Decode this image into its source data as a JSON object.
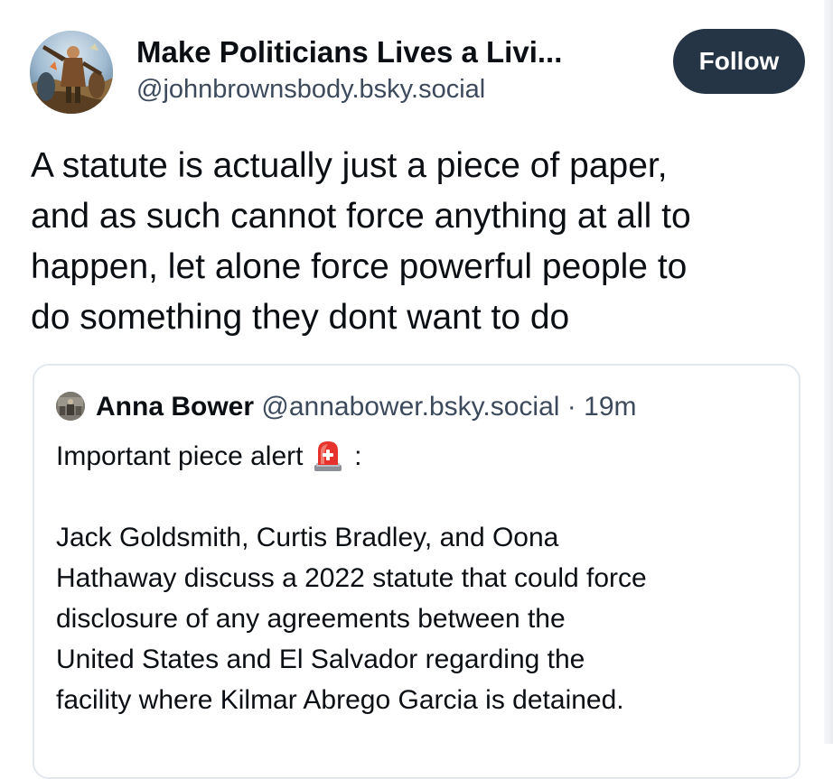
{
  "post": {
    "author": {
      "display_name": "Make Politicians Lives a Livi...",
      "handle": "@johnbrownsbody.bsky.social"
    },
    "follow_label": "Follow",
    "text": "A statute is actually just a piece of paper,\nand as such cannot force anything at all to\nhappen, let alone force powerful people to\ndo something they dont want to do"
  },
  "quote": {
    "author_name": "Anna Bower",
    "author_handle": "@annabower.bsky.social",
    "separator": "·",
    "time": "19m",
    "line1_text": "Important piece alert",
    "line1_suffix": ":",
    "line1_icon": "siren-emoji",
    "paragraph": "Jack Goldsmith, Curtis Bradley, and Oona\nHathaway discuss a 2022 statute that could force\ndisclosure of any agreements between the\nUnited States and El Salvador regarding the\nfacility where Kilmar Abrego Garcia is detained."
  },
  "colors": {
    "follow_button_bg": "#263545",
    "secondary_text": "#3c4a5c",
    "card_border": "#e3e8ee"
  }
}
